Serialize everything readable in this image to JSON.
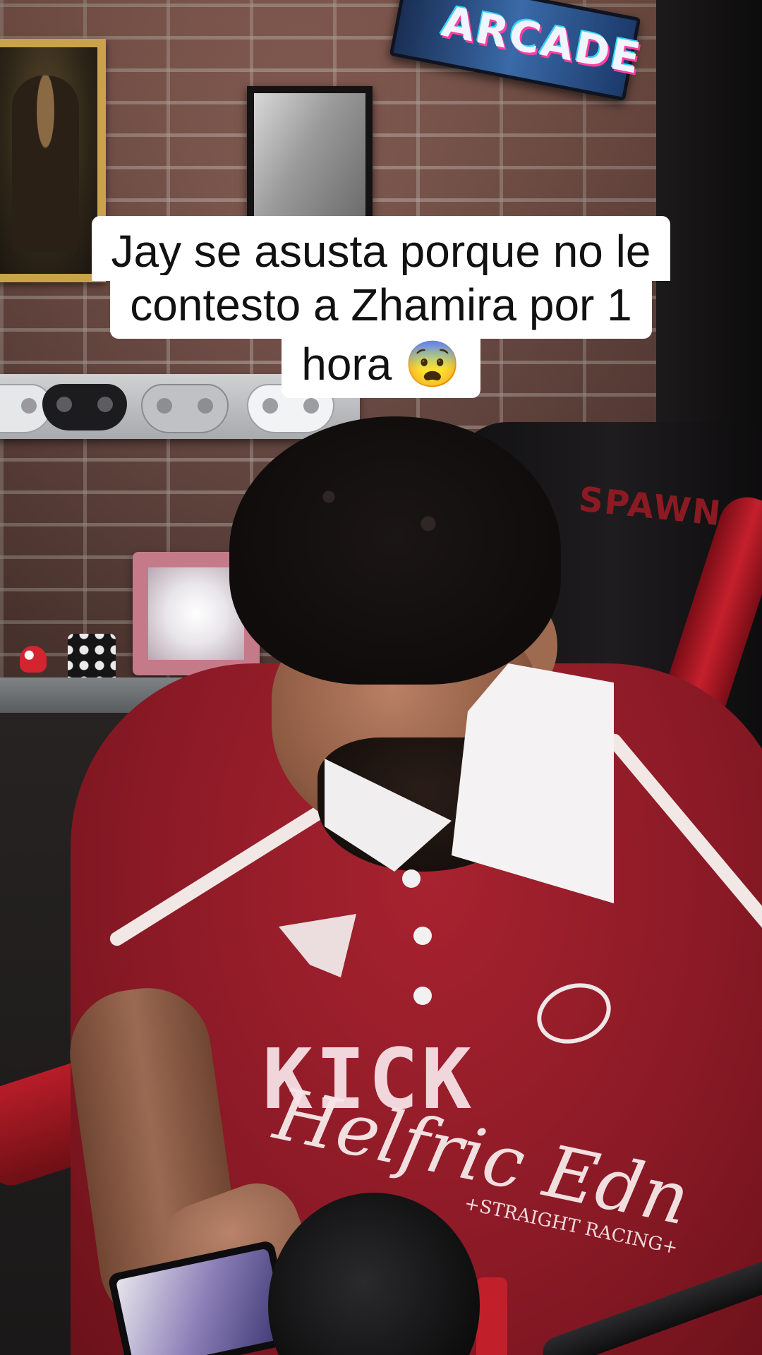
{
  "caption": {
    "line1": "Jay se asusta porque no le",
    "line2": "contesto a Zhamira por 1",
    "line3": "hora 😨"
  },
  "background": {
    "arcade_sign": "ARCADE",
    "chair_brand": "SPAWN"
  },
  "shirt": {
    "script_text": "Helfric Edn",
    "subtext": "+STRAIGHT RACING+"
  },
  "watermark": {
    "text": "KICK"
  },
  "colors": {
    "shirt_red": "#8b1a26",
    "caption_bg": "#ffffff",
    "caption_text": "#111111",
    "chair_red": "#c4202c"
  }
}
